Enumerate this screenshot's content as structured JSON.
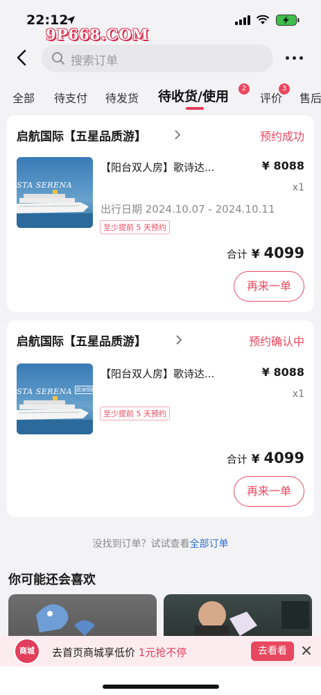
{
  "status_bar": {
    "time": "22:12",
    "watermark": "9P668.COM"
  },
  "header": {
    "search_placeholder": "搜索订单",
    "back_icon": "chevron-left-icon",
    "more_icon": "more-horizontal-icon"
  },
  "tabs": [
    {
      "label": "全部",
      "active": false
    },
    {
      "label": "待支付",
      "active": false
    },
    {
      "label": "待发货",
      "active": false
    },
    {
      "label": "待收货/使用",
      "active": true,
      "badge": "2"
    },
    {
      "label": "评价",
      "active": false,
      "badge": "3"
    },
    {
      "label": "售后",
      "active": false
    }
  ],
  "orders": [
    {
      "shop": "启航国际【五星品质游】",
      "status": "预约成功",
      "thumb_text": "STA SERENA",
      "title": "【阳台双人房】歌诗达...",
      "price": "¥ 8088",
      "qty": "x1",
      "travel_date": "出行日期 2024.10.07 - 2024.10.11",
      "notice": "至少提前 5 天预约",
      "total_label": "合计",
      "total_currency": "¥",
      "total_amount": "4099",
      "button": "再来一单"
    },
    {
      "shop": "启航国际【五星品质游】",
      "status": "预约确认中",
      "thumb_text": "STA SERENA",
      "thumb_tag": "欧洲领航",
      "title": "【阳台双人房】歌诗达...",
      "price": "¥ 8088",
      "qty": "x1",
      "notice": "至少提前 5 天预约",
      "total_label": "合计",
      "total_currency": "¥",
      "total_amount": "4099",
      "button": "再来一单"
    }
  ],
  "not_found": {
    "text": "没找到订单？试试查看",
    "link": "全部订单"
  },
  "recommend": {
    "title": "你可能还会喜欢"
  },
  "promo": {
    "icon_label": "商城",
    "text_prefix": "去首页商城享低价",
    "text_highlight": "1元抢不停",
    "button": "去看看"
  },
  "colors": {
    "accent": "#e8485f",
    "link": "#2f6fd1",
    "background": "#f3f3f5"
  }
}
